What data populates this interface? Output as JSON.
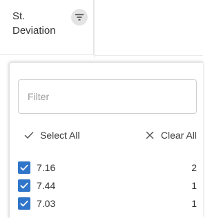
{
  "column": {
    "title": "St.\nDeviation",
    "filter_icon": "filter-icon"
  },
  "filter_panel": {
    "search": {
      "placeholder": "Filter",
      "value": ""
    },
    "actions": {
      "select_all_label": "Select All",
      "select_all_icon": "checkmark-icon",
      "clear_all_label": "Clear All",
      "clear_all_icon": "close-icon"
    },
    "items": [
      {
        "label": "7.16",
        "count": "2",
        "checked": true
      },
      {
        "label": "7.44",
        "count": "1",
        "checked": true
      },
      {
        "label": "7.03",
        "count": "1",
        "checked": true
      }
    ]
  },
  "colors": {
    "checkbox_checked": "#2f75c9",
    "filter_button_bg": "#e4e4e4",
    "border": "#cfcfcf"
  }
}
